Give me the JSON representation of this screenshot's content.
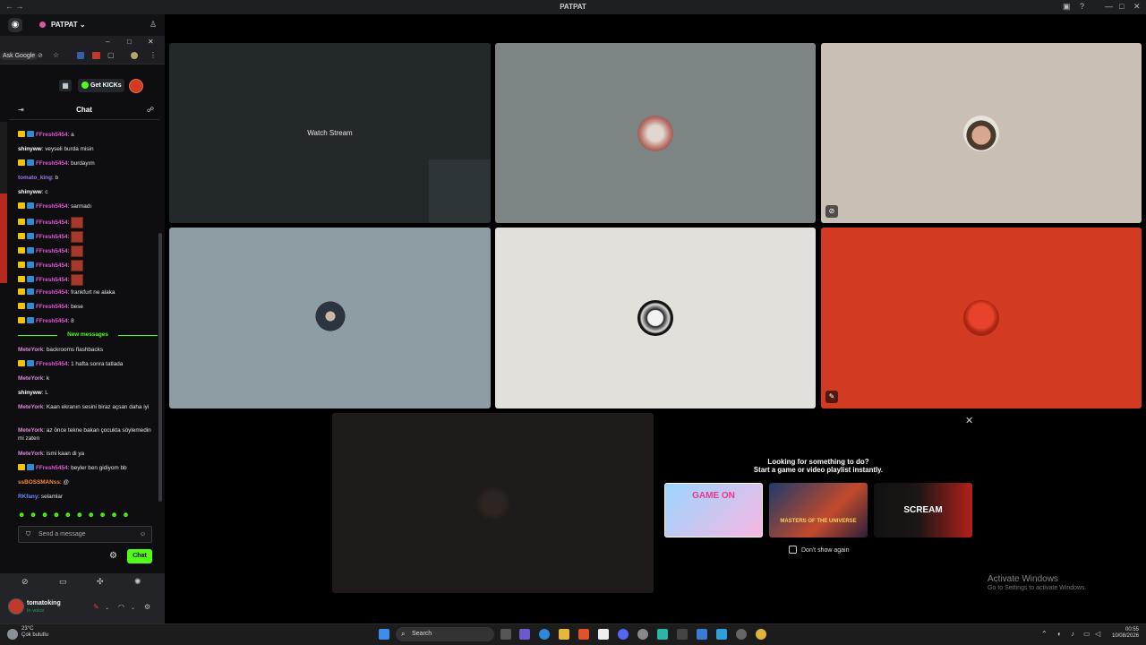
{
  "window": {
    "title": "PATPAT",
    "controls": [
      "—",
      "□",
      "✕"
    ]
  },
  "server": {
    "name": "PATPAT ⌄"
  },
  "popout": {
    "url_snippet": "Ask Google",
    "get_kicks_label": "Get KICKs"
  },
  "chat": {
    "header": "Chat",
    "new_messages_label": "New messages",
    "input_placeholder": "Send a message",
    "send_label": "Chat",
    "messages": [
      {
        "user": "FFresh5454",
        "text": ": a",
        "badges": true,
        "color": "pink"
      },
      {
        "user": "shinyww",
        "text": ": veyseli burda misin",
        "badges": false,
        "color": "white"
      },
      {
        "user": "FFresh5454",
        "text": ": burdayım",
        "badges": true,
        "color": "pink"
      },
      {
        "user": "tomato_king",
        "text": ": b",
        "badges": false,
        "color": "purple"
      },
      {
        "user": "shinyww",
        "text": ": c",
        "badges": false,
        "color": "white"
      },
      {
        "user": "FFresh5454",
        "text": ": sarmadı",
        "badges": true,
        "color": "pink"
      },
      {
        "user": "FFresh5454",
        "text": ":",
        "badges": true,
        "color": "pink",
        "emote": true
      },
      {
        "user": "FFresh5454",
        "text": ":",
        "badges": true,
        "color": "pink",
        "emote": true
      },
      {
        "user": "FFresh5454",
        "text": ":",
        "badges": true,
        "color": "pink",
        "emote": true
      },
      {
        "user": "FFresh5454",
        "text": ":",
        "badges": true,
        "color": "pink",
        "emote": true
      },
      {
        "user": "FFresh5454",
        "text": ":",
        "badges": true,
        "color": "pink",
        "emote": true
      },
      {
        "user": "FFresh5454",
        "text": ": frankfurt ne alaka",
        "badges": true,
        "color": "pink"
      },
      {
        "user": "FFresh5454",
        "text": ": bese",
        "badges": true,
        "color": "pink"
      },
      {
        "user": "FFresh5454",
        "text": ": 8",
        "badges": true,
        "color": "pink"
      }
    ],
    "after_messages": [
      {
        "user": "MeteYork",
        "text": ": backrooms flashbacks",
        "badges": false,
        "color": "mete"
      },
      {
        "user": "FFresh5454",
        "text": ": 1 hafta sonra tatlada",
        "badges": true,
        "color": "pink"
      },
      {
        "user": "MeteYork",
        "text": ": k",
        "badges": false,
        "color": "mete"
      },
      {
        "user": "shinyww",
        "text": ": L",
        "badges": false,
        "color": "white"
      },
      {
        "user": "MeteYork",
        "text": ": Kaan ekranın sesini biraz açsan daha iyi",
        "badges": false,
        "color": "mete",
        "wrap": true
      },
      {
        "user": "MeteYork",
        "text": ": az önce tekne bakan çocukta söylemedin mi zaten",
        "badges": false,
        "color": "mete",
        "wrap": true
      },
      {
        "user": "MeteYork",
        "text": ": ismi kaan di ya",
        "badges": false,
        "color": "mete"
      },
      {
        "user": "FFresh5454",
        "text": ": beyler ben gidiyom bb",
        "badges": true,
        "color": "pink"
      },
      {
        "user": "ssBOSSMANss",
        "text": ": @",
        "badges": false,
        "color": "orange"
      },
      {
        "user": "RKfany",
        "text": ": selamlar",
        "badges": false,
        "color": "blue"
      }
    ]
  },
  "user_panel": {
    "name": "tomatoking",
    "status": "In voice"
  },
  "stream_tile": {
    "watch_label": "Watch Stream"
  },
  "activity": {
    "title": "Looking for something to do?",
    "subtitle": "Start a game or video playlist instantly.",
    "games": [
      "GAME ON",
      "MASTERS OF THE UNIVERSE",
      "SCREAM"
    ],
    "dont_show_label": "Don't show again"
  },
  "activate_windows": {
    "line1": "Activate Windows",
    "line2": "Go to Settings to activate Windows."
  },
  "taskbar": {
    "weather_temp": "23°C",
    "weather_desc": "Çok bulutlu",
    "search_label": "Search",
    "time": "00:55",
    "date": "10/08/2026"
  },
  "colors": {
    "kick_green": "#53fc18",
    "discord_dark": "#1e1f22",
    "tomato_red": "#d33a22"
  }
}
